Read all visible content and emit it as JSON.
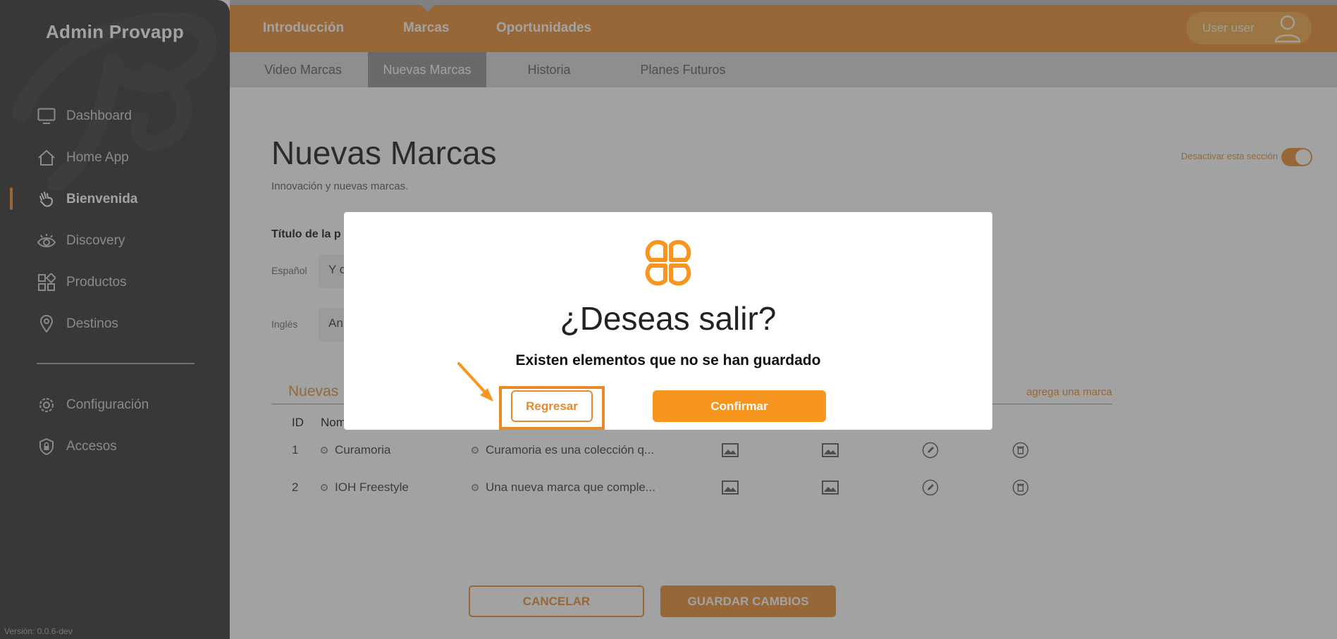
{
  "sidebar": {
    "title": "Admin Provapp",
    "items": [
      {
        "label": "Dashboard",
        "icon": "monitor-icon"
      },
      {
        "label": "Home App",
        "icon": "home-icon"
      },
      {
        "label": "Bienvenida",
        "icon": "waving-hand-icon",
        "active": true
      },
      {
        "label": "Discovery",
        "icon": "eye-icon"
      },
      {
        "label": "Productos",
        "icon": "grid-icon"
      },
      {
        "label": "Destinos",
        "icon": "location-pin-icon"
      }
    ],
    "secondary_items": [
      {
        "label": "Configuración",
        "icon": "gear-icon"
      },
      {
        "label": "Accesos",
        "icon": "shield-lock-icon"
      }
    ],
    "version": "Versión: 0.0.6-dev"
  },
  "topnav": {
    "tabs": [
      "Introducción",
      "Marcas",
      "Oportunidades"
    ],
    "active": "Marcas",
    "user_label": "User user"
  },
  "subnav": {
    "tabs": [
      "Video Marcas",
      "Nuevas Marcas",
      "Historia",
      "Planes Futuros"
    ],
    "active": "Nuevas Marcas"
  },
  "page": {
    "title": "Nuevas Marcas",
    "subtitle": "Innovación y nuevas marcas.",
    "toggle_label": "Desactivar esta sección",
    "field_title": "Título de la p",
    "spanish_label": "Español",
    "spanish_value": "Y c",
    "english_label": "Inglés",
    "english_value": "An",
    "list_title": "Nuevas",
    "add_link": "agrega una marca",
    "columns": [
      "ID",
      "Nom"
    ],
    "rows": [
      {
        "id": "1",
        "name": "Curamoria",
        "description": "Curamoria es una colección q..."
      },
      {
        "id": "2",
        "name": "IOH Freestyle",
        "description": "Una nueva marca que comple..."
      }
    ],
    "cancel_label": "CANCELAR",
    "save_label": "GUARDAR CAMBIOS"
  },
  "modal": {
    "title": "¿Deseas salir?",
    "message": "Existen elementos que no se han guardado",
    "back_label": "Regresar",
    "confirm_label": "Confirmar",
    "logo_icon": "clover-logo-icon"
  },
  "colors": {
    "accent": "#e8892a",
    "sidebar_bg": "#2a2a2a",
    "confirm": "#f7951e"
  }
}
